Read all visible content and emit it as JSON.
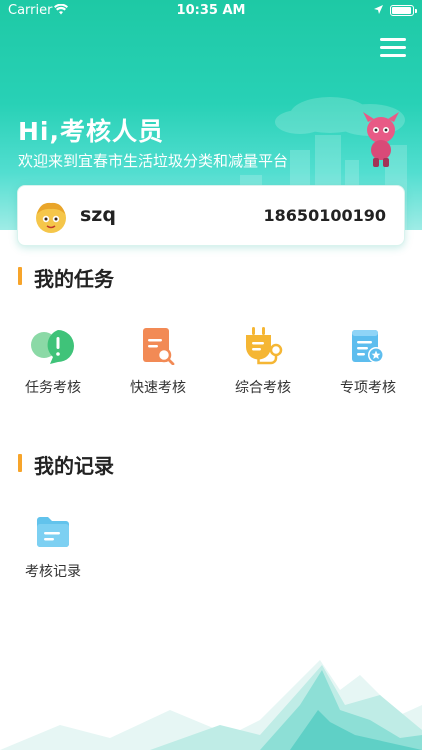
{
  "status_bar": {
    "carrier": "Carrier",
    "time": "10:35 AM"
  },
  "header": {
    "greeting": "Hi,考核人员",
    "welcome": "欢迎来到宜春市生活垃圾分类和减量平台"
  },
  "user": {
    "name": "szq",
    "phone": "18650100190"
  },
  "sections": {
    "tasks": {
      "title": "我的任务",
      "items": [
        {
          "label": "任务考核",
          "icon": "task-review-icon"
        },
        {
          "label": "快速考核",
          "icon": "quick-review-icon"
        },
        {
          "label": "综合考核",
          "icon": "comprehensive-review-icon"
        },
        {
          "label": "专项考核",
          "icon": "special-review-icon"
        }
      ]
    },
    "records": {
      "title": "我的记录",
      "items": [
        {
          "label": "考核记录",
          "icon": "review-records-icon"
        }
      ]
    }
  },
  "colors": {
    "accent": "#f7a42a",
    "brand": "#1ec9a5"
  }
}
